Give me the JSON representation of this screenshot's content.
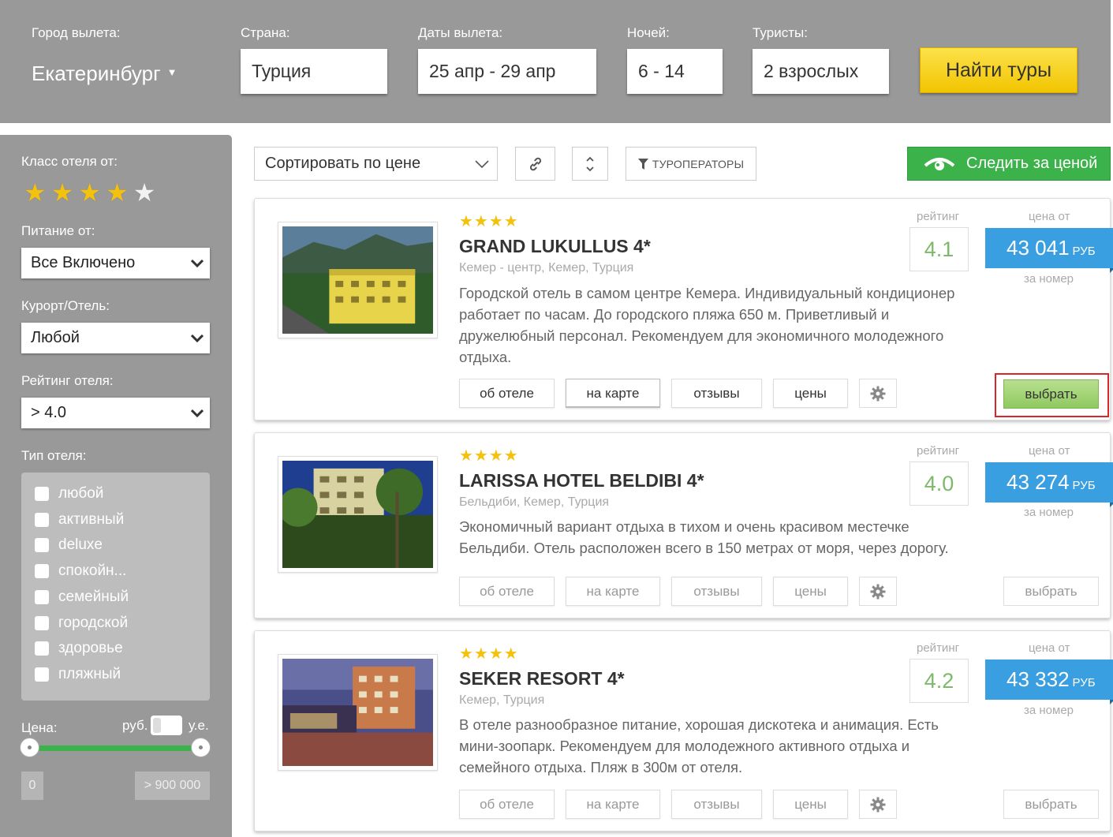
{
  "search": {
    "city_label": "Город вылета:",
    "city_value": "Екатеринбург",
    "country_label": "Страна:",
    "country_value": "Турция",
    "dates_label": "Даты вылета:",
    "dates_value": "25 апр - 29 апр",
    "nights_label": "Ночей:",
    "nights_value": "6 - 14",
    "tourists_label": "Туристы:",
    "tourists_value": "2 взрослых",
    "find_button": "Найти туры"
  },
  "filters": {
    "hotel_class_label": "Класс отеля от:",
    "hotel_class_selected": 4,
    "hotel_class_max": 5,
    "meal_label": "Питание от:",
    "meal_value": "Все Включено",
    "resort_label": "Курорт/Отель:",
    "resort_value": "Любой",
    "rating_label": "Рейтинг отеля:",
    "rating_value": "> 4.0",
    "type_label": "Тип отеля:",
    "types": [
      "любой",
      "активный",
      "deluxe",
      "спокойн...",
      "семейный",
      "городской",
      "здоровье",
      "пляжный"
    ],
    "price_label": "Цена:",
    "currency_rub": "руб.",
    "currency_ue": "у.е.",
    "price_min": "0",
    "price_max": "> 900 000"
  },
  "toolbar": {
    "sort_value": "Сортировать по цене",
    "tour_operators": "ТУРОПЕРАТОРЫ",
    "watch_price": "Следить за ценой"
  },
  "labels": {
    "rating": "рейтинг",
    "price_from": "цена от",
    "currency": "РУБ",
    "per_room": "за номер",
    "about": "об отеле",
    "on_map": "на карте",
    "reviews": "отзывы",
    "prices": "цены",
    "choose": "выбрать"
  },
  "hotels": [
    {
      "stars": "★★★★",
      "name": "GRAND LUKULLUS 4*",
      "location": "Кемер - центр, Кемер, Турция",
      "description": "Городской отель в самом центре Кемера. Индивидуальный кондиционер работает по часам. До городского пляжа 650 м. Приветливый и дружелюбный персонал. Рекомендуем для экономичного молодежного отдыха.",
      "rating": "4.1",
      "price": "43 041"
    },
    {
      "stars": "★★★★",
      "name": "LARISSA HOTEL BELDIBI 4*",
      "location": "Бельдиби, Кемер, Турция",
      "description": "Экономичный вариант отдыха в тихом и очень красивом местечке Бельдиби. Отель расположен всего в 150 метрах от моря, через дорогу.",
      "rating": "4.0",
      "price": "43 274"
    },
    {
      "stars": "★★★★",
      "name": "SEKER RESORT 4*",
      "location": "Кемер, Турция",
      "description": "В отеле разнообразное питание, хорошая дискотека и анимация. Есть мини-зоопарк. Рекомендуем для молодежного активного отдыха и семейного отдыха. Пляж в 300м от отеля.",
      "rating": "4.2",
      "price": "43 332"
    }
  ],
  "colors": {
    "panel": "#999999",
    "accent_green": "#3cb34a",
    "price_blue": "#3a9fe0",
    "find_yellow": "#f2c500",
    "highlight_red": "#d9262b"
  }
}
